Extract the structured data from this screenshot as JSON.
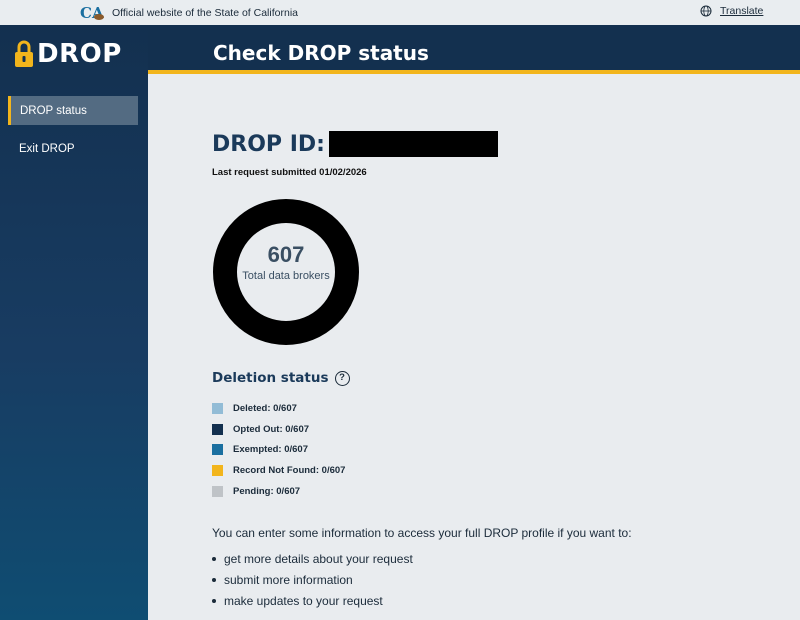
{
  "state_banner": {
    "logo_text": "CA",
    "text": "Official website of the State of California",
    "translate_label": "Translate",
    "translate_icon": "globe-icon"
  },
  "sidebar": {
    "brand": "DROP",
    "brand_icon": "lock-icon",
    "items": [
      {
        "label": "DROP status",
        "active": true
      },
      {
        "label": "Exit DROP",
        "active": false
      }
    ]
  },
  "header": {
    "title": "Check DROP status"
  },
  "main": {
    "drop_id_label": "DROP ID:",
    "drop_id_value": "",
    "last_request": "Last request submitted 01/02/2026",
    "donut": {
      "count": "607",
      "caption": "Total data brokers"
    },
    "deletion_status": {
      "title": "Deletion status",
      "help_icon": "question-icon",
      "items": [
        {
          "label": "Deleted: 0/607",
          "color": "#92bcd6"
        },
        {
          "label": "Opted Out: 0/607",
          "color": "#13304f"
        },
        {
          "label": "Exempted: 0/607",
          "color": "#1a6fa0"
        },
        {
          "label": "Record Not Found: 0/607",
          "color": "#f2b51c"
        },
        {
          "label": "Pending: 0/607",
          "color": "#bfc3c7"
        }
      ]
    },
    "info_text": "You can enter some information to access your full DROP profile if you want to:",
    "bullets": [
      "get more details about your request",
      "submit more information",
      "make updates to your request"
    ]
  },
  "colors": {
    "navy": "#13304f",
    "accent_gold": "#f2b51c",
    "active_nav": "#536b82",
    "donut_ring": "#000000"
  }
}
